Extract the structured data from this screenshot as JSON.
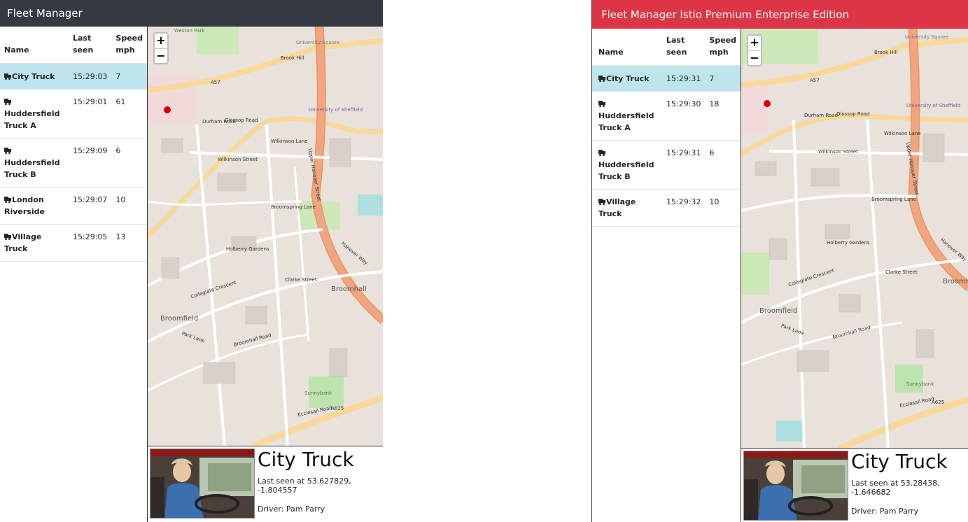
{
  "left": {
    "title": "Fleet Manager",
    "columns": [
      "Name",
      "Last seen",
      "Speed mph"
    ],
    "rows": [
      {
        "name": "City Truck",
        "last_seen": "15:29:03",
        "speed": "7",
        "selected": true
      },
      {
        "name": "Huddersfield Truck A",
        "last_seen": "15:29:01",
        "speed": "61"
      },
      {
        "name": "Huddersfield Truck B",
        "last_seen": "15:29:09",
        "speed": "6"
      },
      {
        "name": "London Riverside",
        "last_seen": "15:29:07",
        "speed": "10"
      },
      {
        "name": "Village Truck",
        "last_seen": "15:29:05",
        "speed": "13"
      }
    ],
    "map": {
      "zoom_in": "+",
      "zoom_out": "−"
    },
    "detail": {
      "name": "City Truck",
      "last_seen_text": "Last seen at 53.627829, -1.804557",
      "driver_text": "Driver: Pam Parry"
    }
  },
  "right": {
    "title": "Fleet Manager Istio Premium Enterprise Edition",
    "columns": [
      "Name",
      "Last seen",
      "Speed mph"
    ],
    "rows": [
      {
        "name": "City Truck",
        "last_seen": "15:29:31",
        "speed": "7",
        "selected": true
      },
      {
        "name": "Huddersfield Truck A",
        "last_seen": "15:29:30",
        "speed": "18"
      },
      {
        "name": "Huddersfield Truck B",
        "last_seen": "15:29:31",
        "speed": "6"
      },
      {
        "name": "Village Truck",
        "last_seen": "15:29:32",
        "speed": "10"
      }
    ],
    "map": {
      "zoom_in": "+",
      "zoom_out": "−"
    },
    "detail": {
      "name": "City Truck",
      "last_seen_text": "Last seen at 53.28438, -1.646682",
      "driver_text": "Driver: Pam Parry"
    }
  },
  "map_labels": {
    "university_square": "University Square",
    "brook_hill": "Brook Hill",
    "glossop_road": "Glossop Road",
    "durham_road": "Durham Road",
    "wilkinson_lane": "Wilkinson Lane",
    "wilkinson_street": "Wilkinson Street",
    "upper_hanover": "Upper Hanover Street",
    "broomspring": "Broomspring Lane",
    "holberry": "Holberry Gardens",
    "collegiate": "Collegiate Crescent",
    "clarke": "Clarke Street",
    "broomhall_road": "Broomhall Road",
    "broomfield": "Broomfield",
    "broomhall": "Broomhall",
    "park_lane": "Park Lane",
    "ecclesall": "Ecclesall Road",
    "a625": "A625",
    "a57": "A57",
    "hanover_way": "Hanover Way",
    "sunnybank": "Sunnybank",
    "university_sheffield": "University of Sheffield",
    "weston_park": "Weston Park"
  },
  "colors": {
    "navbar_dark": "#343a40",
    "navbar_red": "#dc3545",
    "selected_row": "#bee5eb",
    "main_road": "#f2a57f",
    "secondary_road": "#f9d89b"
  },
  "icons": [
    "truck-icon",
    "map-marker-icon"
  ]
}
